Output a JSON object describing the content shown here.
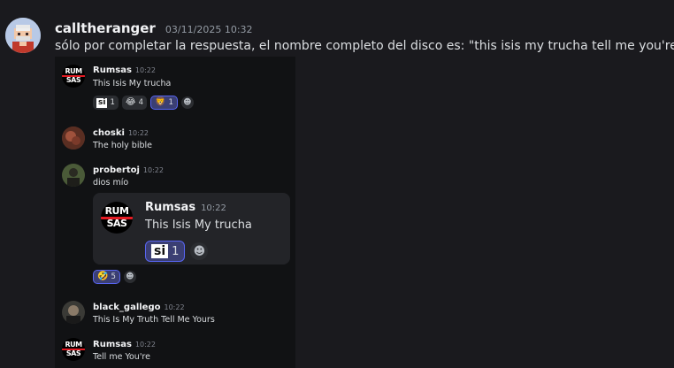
{
  "message": {
    "author": "calltheranger",
    "timestamp": "03/11/2025 10:32",
    "content": "sólo por completar la respuesta, el nombre completo del disco es: \"this isis my trucha tell me you're\""
  },
  "screenshot": {
    "logo_text_top": "RUM",
    "logo_text_bottom": "SAS",
    "messages": [
      {
        "author": "Rumsas",
        "time": "10:22",
        "text": "This Isis My trucha",
        "reactions": [
          {
            "emoji": "si",
            "count": "1"
          },
          {
            "emoji": "😂",
            "count": "4"
          },
          {
            "emoji": "🦁",
            "count": "1"
          }
        ],
        "add_reaction": "☻"
      },
      {
        "author": "choski",
        "time": "10:22",
        "text": "The holy bible"
      },
      {
        "author": "probertoj",
        "time": "10:22",
        "text": "dios mío"
      },
      {
        "author": "black_gallego",
        "time": "10:22",
        "text": "This Is My Truth Tell Me Yours"
      },
      {
        "author": "Rumsas",
        "time": "10:22",
        "text": "Tell me You're"
      }
    ],
    "quoted": {
      "author": "Rumsas",
      "time": "10:22",
      "text": "This Isis My trucha",
      "reaction_label": "si",
      "reaction_count": "1",
      "add_reaction": "☻"
    },
    "extra_reactions": [
      {
        "emoji": "🤣",
        "count": "5"
      }
    ],
    "extra_add_reaction": "☻"
  },
  "colors": {
    "background": "#1a1a1e",
    "mention_highlight": "#5865f2",
    "logo_red": "#e31b23"
  }
}
